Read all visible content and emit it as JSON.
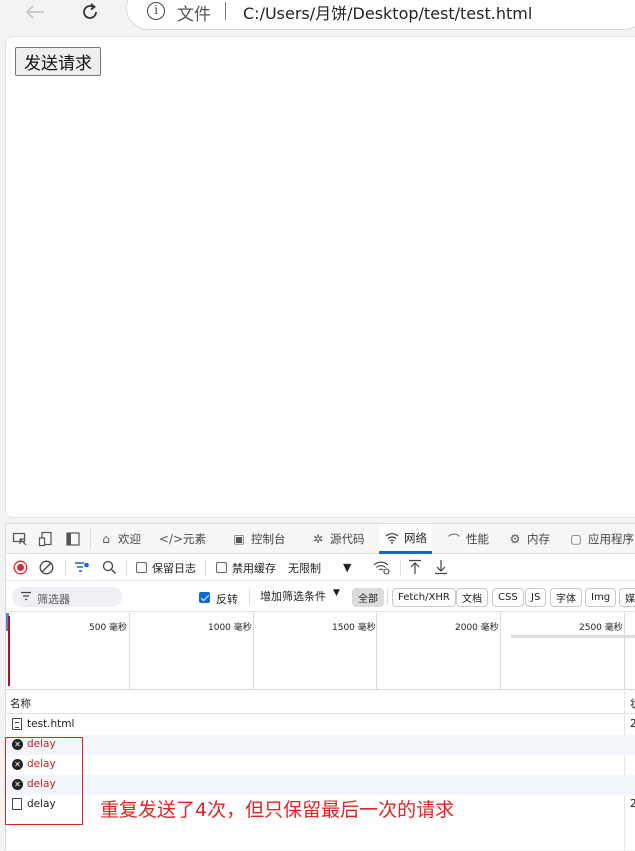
{
  "browser": {
    "file_label": "文件",
    "url": "C:/Users/月饼/Desktop/test/test.html"
  },
  "page": {
    "send_button": "发送请求"
  },
  "devtools": {
    "tabs": [
      {
        "label": "欢迎",
        "icon": "home-icon"
      },
      {
        "label": "元素",
        "icon": "code-icon"
      },
      {
        "label": "控制台",
        "icon": "console-icon"
      },
      {
        "label": "源代码",
        "icon": "bug-icon"
      },
      {
        "label": "网络",
        "icon": "wifi-icon"
      },
      {
        "label": "性能",
        "icon": "gauge-icon"
      },
      {
        "label": "内存",
        "icon": "chip-icon"
      },
      {
        "label": "应用程序",
        "icon": "app-icon"
      }
    ],
    "active_tab": "网络",
    "toolbar": {
      "preserve_log": "保留日志",
      "disable_cache": "禁用缓存",
      "throttling": "无限制"
    },
    "filter": {
      "placeholder": "筛选器",
      "invert": "反转",
      "more_filters": "增加筛选条件",
      "types": [
        "全部",
        "Fetch/XHR",
        "文档",
        "CSS",
        "JS",
        "字体",
        "Img",
        "媒"
      ],
      "selected_type": "全部"
    },
    "overview": {
      "ticks": [
        "500 毫秒",
        "1000 毫秒",
        "1500 毫秒",
        "2000 毫秒",
        "2500 毫秒"
      ]
    },
    "table": {
      "header_name": "名称",
      "header_status": "状",
      "rows": [
        {
          "name": "test.html",
          "status": "2",
          "error": false
        },
        {
          "name": "delay",
          "status": "",
          "error": true
        },
        {
          "name": "delay",
          "status": "",
          "error": true
        },
        {
          "name": "delay",
          "status": "",
          "error": true
        },
        {
          "name": "delay",
          "status": "2",
          "error": false
        }
      ]
    }
  },
  "annotation": "重复发送了4次，但只保留最后一次的请求",
  "colors": {
    "accent": "#0a6bd5",
    "error": "#c5221f",
    "annotation": "#e02424"
  }
}
